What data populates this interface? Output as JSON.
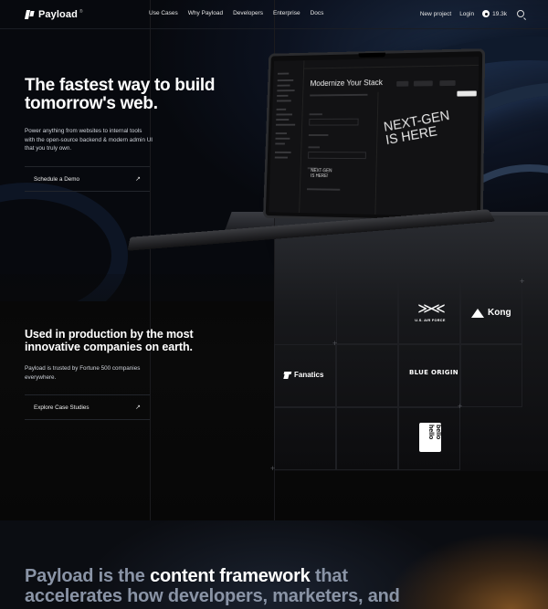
{
  "nav": {
    "brand": "Payload",
    "brand_mark": "®",
    "links": [
      "Use Cases",
      "Why Payload",
      "Developers",
      "Enterprise",
      "Docs"
    ],
    "new_project": "New project",
    "login": "Login",
    "github_stars": "19.3k"
  },
  "hero": {
    "title": "The fastest way to build tomorrow's web.",
    "subtitle": "Power anything from websites to internal tools with the open-source backend & modern admin UI that you truly own.",
    "cta_label": "Schedule a Demo",
    "cta_arrow": "↗"
  },
  "laptop": {
    "doc_title": "Modernize Your Stack",
    "preview_headline_1": "NEXT-GEN",
    "preview_headline_2": "IS HERE",
    "field_headline_1": "NEXT-GEN",
    "field_headline_2": "IS HERE!"
  },
  "customers": {
    "title": "Used in production by the most innovative companies on earth.",
    "subtitle": "Payload is trusted by Fortune 500 companies everywhere.",
    "cta_label": "Explore Case Studies",
    "cta_arrow": "↗",
    "logos": {
      "fanatics": "Fanatics",
      "airforce": "U.S. AIR FORCE",
      "kong": "Kong",
      "blue_origin": "BLUE ORIGIN",
      "hello_1": "hello",
      "hello_2": "bello"
    }
  },
  "framework": {
    "part1": "Payload is the ",
    "part2": "content framework",
    "part3": " that accelerates how developers, marketers, and"
  },
  "colors": {
    "background": "#070707",
    "accent_glow": "#7a4f22",
    "muted_text": "#8a94a6"
  },
  "icons": [
    "github-icon",
    "search-icon",
    "arrow-up-right-icon"
  ]
}
